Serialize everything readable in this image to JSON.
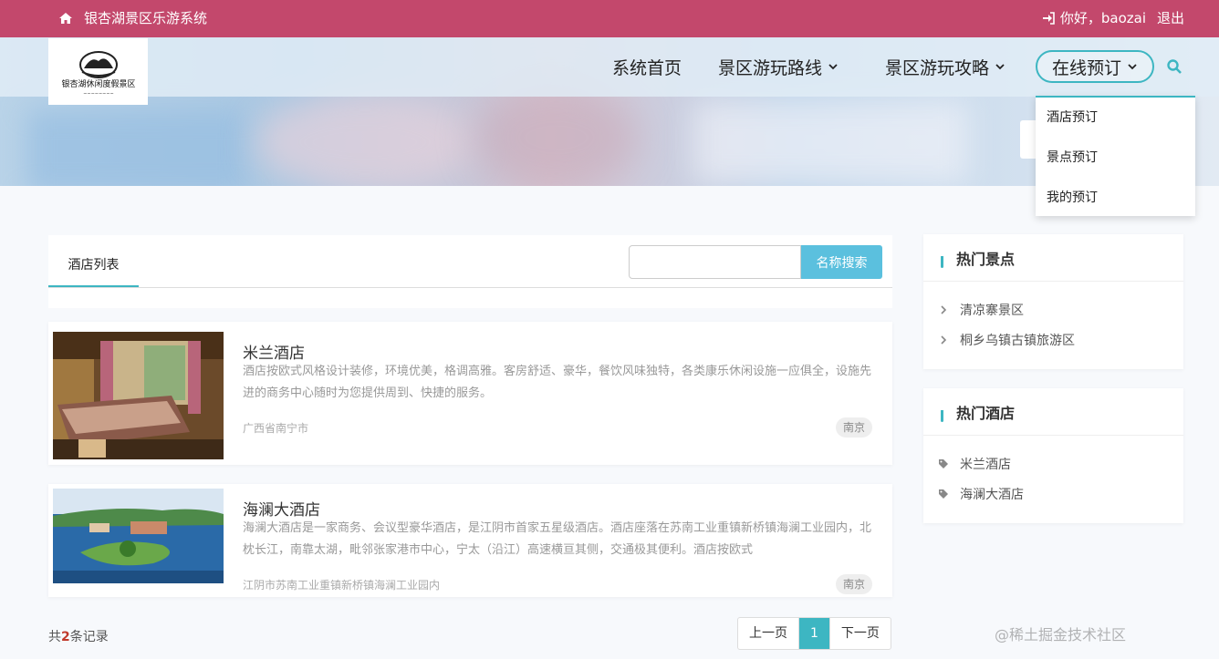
{
  "topbar": {
    "site_name": "银杏湖景区乐游系统",
    "greeting": "你好，baozai",
    "logout": "退出"
  },
  "logo": {
    "line1": "银杏湖休闲度假景区"
  },
  "nav": {
    "home": "系统首页",
    "routes": "景区游玩路线",
    "guides": "景区游玩攻略",
    "booking": "在线预订"
  },
  "dropdown": [
    "酒店预订",
    "景点预订",
    "我的预订"
  ],
  "list": {
    "tab": "酒店列表",
    "search_placeholder": "",
    "search_button": "名称搜索"
  },
  "hotels": [
    {
      "name": "米兰酒店",
      "description": "酒店按欧式风格设计装修，环境优美，格调高雅。客房舒适、豪华，餐饮风味独特，各类康乐休闲设施一应俱全，设施先进的商务中心随时为您提供周到、快捷的服务。",
      "address": "广西省南宁市",
      "tag": "南京"
    },
    {
      "name": "海澜大酒店",
      "description": "海澜大酒店是一家商务、会议型豪华酒店，是江阴市首家五星级酒店。酒店座落在苏南工业重镇新桥镇海澜工业园内，北枕长江，南靠太湖，毗邻张家港市中心，宁太（沿江）高速横亘其侧，交通极其便利。酒店按欧式",
      "address": "江阴市苏南工业重镇新桥镇海澜工业园内",
      "tag": "南京"
    }
  ],
  "sidebar": {
    "spots_title": "热门景点",
    "spots": [
      "清凉寨景区",
      "桐乡乌镇古镇旅游区"
    ],
    "hotels_title": "热门酒店",
    "hotels": [
      "米兰酒店",
      "海澜大酒店"
    ]
  },
  "footer": {
    "count_prefix": "共",
    "count": "2",
    "count_suffix": "条记录",
    "prev": "上一页",
    "page": "1",
    "next": "下一页"
  },
  "watermark": "@稀土掘金技术社区",
  "colors": {
    "topbar": "#c3486c",
    "accent": "#3db6c2",
    "search_button": "#5bc0de"
  }
}
